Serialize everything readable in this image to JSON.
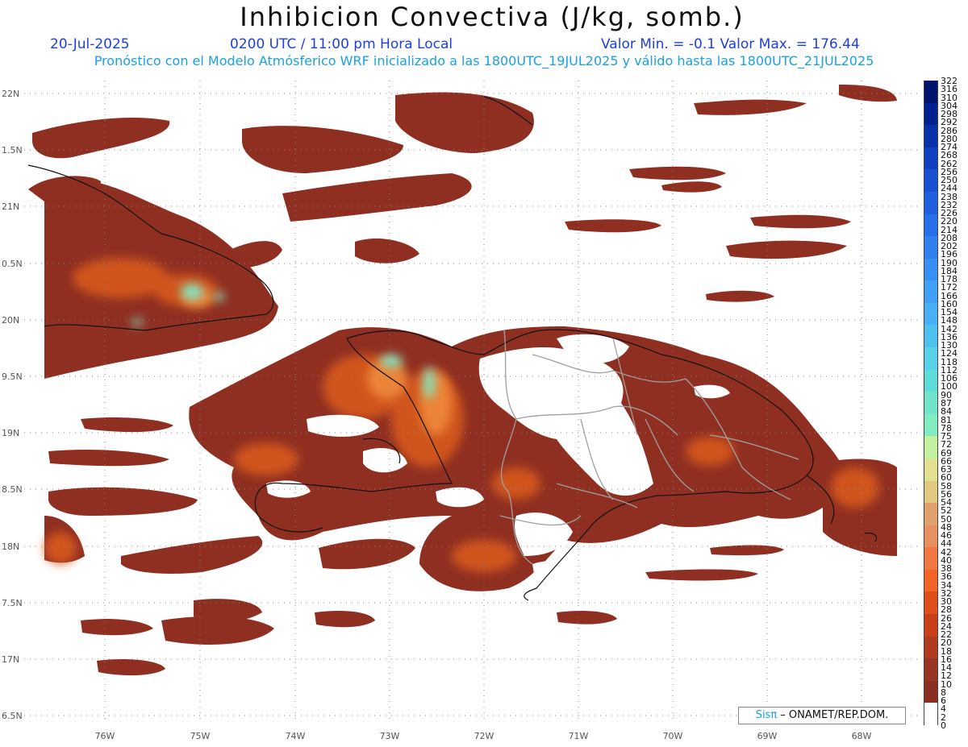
{
  "title": "Inhibicion Convectiva (J/kg, somb.)",
  "header": {
    "date": "20-Jul-2025",
    "time": "0200 UTC / 11:00 pm Hora Local",
    "minmax": "Valor Min. = -0.1  Valor Max. = 176.44",
    "description": "Pronóstico con el Modelo Atmósferico WRF inicializado a las 1800UTC_19JUL2025 y válido hasta las  1800UTC_21JUL2025"
  },
  "axes": {
    "lat_labels": [
      "22N",
      "1.5N",
      "21N",
      "0.5N",
      "20N",
      "9.5N",
      "19N",
      "8.5N",
      "18N",
      "7.5N",
      "17N",
      "6.5N"
    ],
    "lon_labels": [
      "76W",
      "75W",
      "74W",
      "73W",
      "72W",
      "71W",
      "70W",
      "69W",
      "68W"
    ]
  },
  "legend": {
    "labels": [
      "322",
      "316",
      "310",
      "304",
      "298",
      "292",
      "286",
      "280",
      "274",
      "268",
      "262",
      "256",
      "250",
      "244",
      "238",
      "232",
      "226",
      "220",
      "214",
      "208",
      "202",
      "196",
      "190",
      "184",
      "178",
      "172",
      "166",
      "160",
      "154",
      "148",
      "142",
      "136",
      "130",
      "124",
      "118",
      "112",
      "106",
      "100",
      "90",
      "87",
      "84",
      "81",
      "78",
      "75",
      "72",
      "69",
      "66",
      "63",
      "60",
      "58",
      "56",
      "54",
      "52",
      "50",
      "48",
      "46",
      "44",
      "42",
      "40",
      "38",
      "36",
      "34",
      "32",
      "30",
      "28",
      "26",
      "24",
      "22",
      "20",
      "18",
      "16",
      "14",
      "12",
      "10",
      "8",
      "6",
      "4",
      "2",
      "0"
    ],
    "colors": [
      "#00146e",
      "#002090",
      "#0830a8",
      "#1040c0",
      "#1850d4",
      "#2060e0",
      "#2870ea",
      "#3080f0",
      "#3890f4",
      "#40a0f6",
      "#48b0f6",
      "#50c0f0",
      "#58d0e8",
      "#60dcd8",
      "#70e4c8",
      "#80ecc0",
      "#c0f0a0",
      "#e0e090",
      "#e0c880",
      "#e0a070",
      "#e89060",
      "#f07840",
      "#f06428",
      "#e04e1c",
      "#c8401a",
      "#b03a1c",
      "#983422",
      "#8a2e22",
      "#ffffff"
    ]
  },
  "credit": {
    "sis": "Sisπ",
    "rest": " – ONAMET/REP.DOM."
  }
}
